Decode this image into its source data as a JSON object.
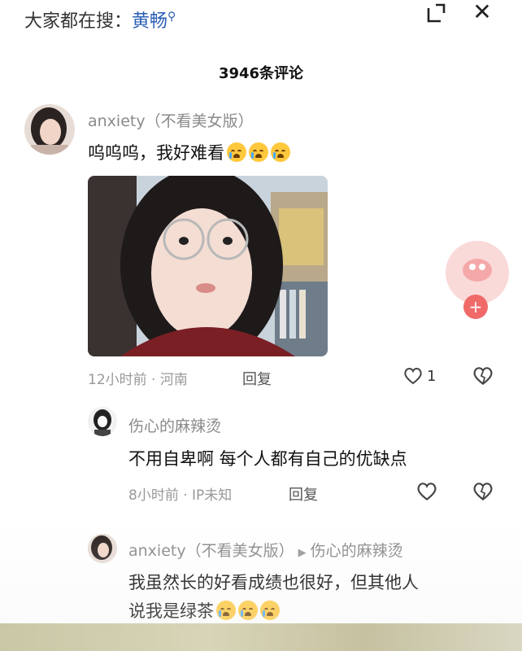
{
  "header": {
    "search_prefix": "大家都在搜：",
    "search_keyword": "黄畅",
    "search_icon": "magnifier-icon",
    "expand_icon": "expand-icon",
    "close_icon": "close-icon",
    "comment_count": "3946条评论"
  },
  "comments": [
    {
      "user": "anxiety（不看美女版）",
      "text": "呜呜呜，我好难看",
      "emoji_count": 3,
      "has_photo": true,
      "meta": "12小时前 · 河南",
      "reply_label": "回复",
      "likes": "1"
    }
  ],
  "replies": [
    {
      "user": "伤心的麻辣烫",
      "text": "不用自卑啊 每个人都有自己的优缺点",
      "meta": "8小时前 · IP未知",
      "reply_label": "回复"
    },
    {
      "user": "anxiety（不看美女版）",
      "reply_to": "伤心的麻辣烫",
      "text_line1": "我虽然长的好看成绩也很好，但其他人",
      "text_line2": "说我是绿茶",
      "emoji_count": 3
    }
  ],
  "colors": {
    "keyword": "#2b5fb3",
    "username": "#8a8a8a",
    "meta": "#999999",
    "float_plus": "#f06a6a"
  }
}
